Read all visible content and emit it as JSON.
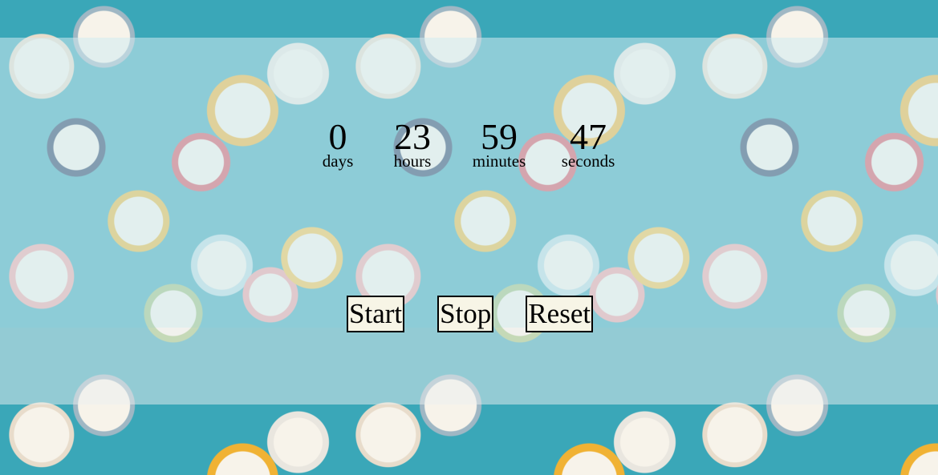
{
  "countdown": {
    "days": {
      "value": "0",
      "label": "days"
    },
    "hours": {
      "value": "23",
      "label": "hours"
    },
    "minutes": {
      "value": "59",
      "label": "minutes"
    },
    "seconds": {
      "value": "47",
      "label": "seconds"
    }
  },
  "controls": {
    "start_label": "Start",
    "stop_label": "Stop",
    "reset_label": "Reset"
  },
  "colors": {
    "button_background": "#f7f5e6",
    "wallpaper_base": "#3aa7b8"
  }
}
